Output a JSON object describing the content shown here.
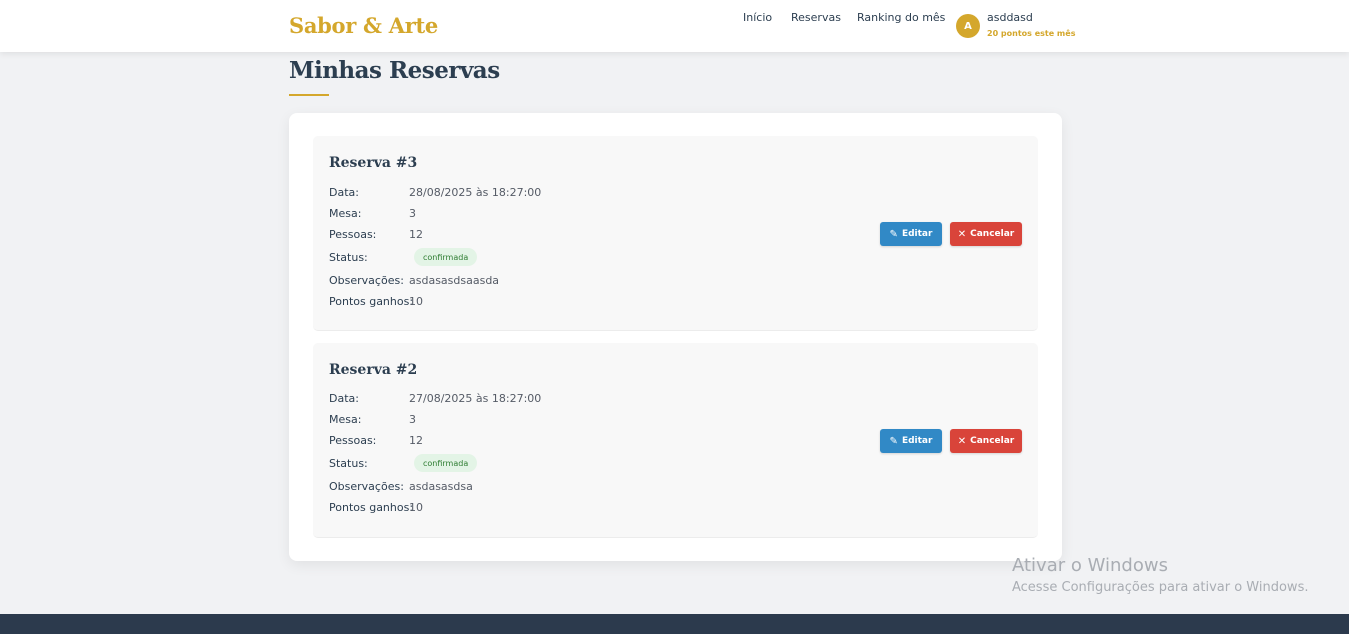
{
  "header": {
    "brand": "Sabor & Arte",
    "nav": [
      "Início",
      "Reservas",
      "Ranking do mês"
    ],
    "user": {
      "initial": "A",
      "name": "asddasd",
      "points": "20 pontos este mês"
    }
  },
  "page": {
    "title": "Minhas Reservas"
  },
  "labels": {
    "date": "Data:",
    "table": "Mesa:",
    "people": "Pessoas:",
    "status": "Status:",
    "notes": "Observações:",
    "points": "Pontos ganhos:",
    "edit": "Editar",
    "cancel": "Cancelar"
  },
  "reservations": [
    {
      "title": "Reserva #3",
      "date": "28/08/2025 às 18:27:00",
      "table": "3",
      "people": "12",
      "status": "confirmada",
      "notes": "asdasasdsaasda",
      "points": "10"
    },
    {
      "title": "Reserva #2",
      "date": "27/08/2025 às 18:27:00",
      "table": "3",
      "people": "12",
      "status": "confirmada",
      "notes": "asdasasdsa",
      "points": "10"
    }
  ],
  "watermark": {
    "title": "Ativar o Windows",
    "subtitle": "Acesse Configurações para ativar o Windows."
  },
  "colors": {
    "accent": "#d4a72c",
    "edit": "#3189c6",
    "cancel": "#d9443a",
    "footer": "#2c3a4d"
  }
}
